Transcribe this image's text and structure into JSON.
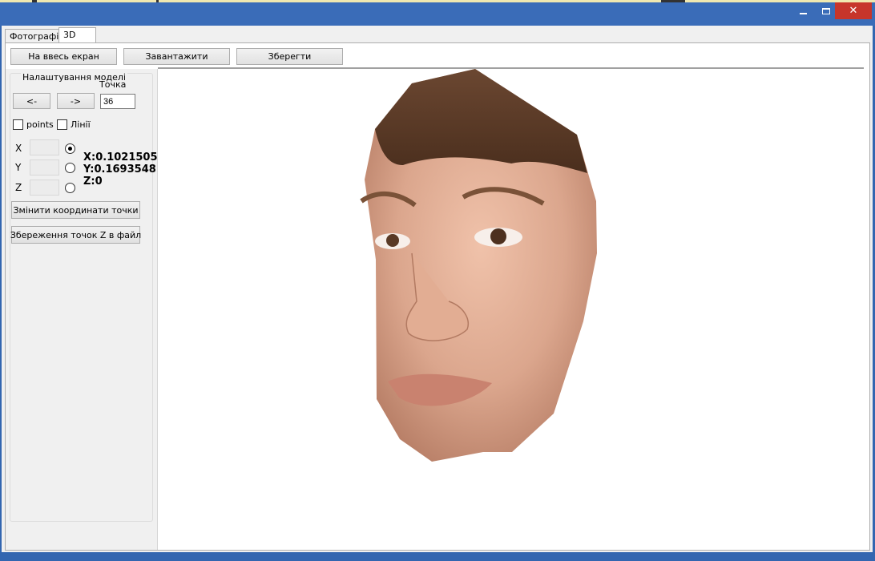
{
  "window": {
    "controls": {
      "minimize_icon": "minimize-icon",
      "maximize_icon": "maximize-icon",
      "close_icon": "close-icon",
      "close_glyph": "✕"
    }
  },
  "tabs": [
    {
      "label": "Фотографії"
    },
    {
      "label": "3D"
    }
  ],
  "toolbar": {
    "fullscreen_label": "На ввесь екран",
    "load_label": "Завантажити",
    "save_label": "Зберегти"
  },
  "settings": {
    "group_title": "Налаштування моделі",
    "point_label": "Точка",
    "prev_label": "<-",
    "next_label": "->",
    "point_value": "36",
    "points_checkbox_label": "points",
    "lines_checkbox_label": "Лінії",
    "x_label": "X",
    "y_label": "Y",
    "z_label": "Z",
    "x_readout": "X:0.1021505",
    "y_readout": "Y:0.1693548",
    "z_readout": "Z:0",
    "change_coords_label": "Змінити координати точки",
    "save_z_label": "Збереження точок Z в файл"
  },
  "colors": {
    "titlebar": "#3a6cb8",
    "close_button": "#c7352b",
    "face_skin": "#d9a58c",
    "hair": "#5a3b28"
  }
}
